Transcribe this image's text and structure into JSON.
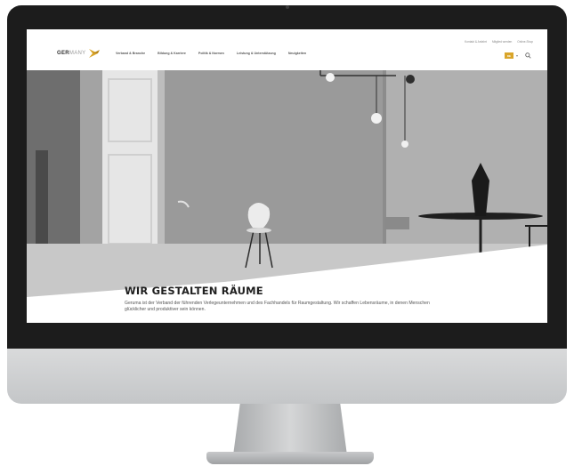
{
  "site": {
    "logo_text": "GERMANY",
    "logo_brand": "GER",
    "logo_suffix": "MANY"
  },
  "main_nav": [
    {
      "label": "Verband & Branche"
    },
    {
      "label": "Bildung & Karriere"
    },
    {
      "label": "Politik & Normen"
    },
    {
      "label": "Leistung & Unterstützung"
    },
    {
      "label": "Neuigkeiten"
    }
  ],
  "utility_nav": [
    {
      "label": "Kontakt & Anfahrt"
    },
    {
      "label": "Mitglied werden"
    },
    {
      "label": "Online-Shop"
    }
  ],
  "header_tools": {
    "language": "DE",
    "search_icon": "search-icon"
  },
  "hero": {
    "title": "WIR GESTALTEN RÄUME",
    "text": "Geruma ist der Verband der führenden Verlegeunternehmen und des Fachhandels für Raumgestaltung. Wir schaffen Lebensräume, in denen Menschen glücklicher und produktiver sein können."
  },
  "colors": {
    "accent": "#d9a52a",
    "hero_bg": "#9b9b9b",
    "bezel": "#1c1c1c"
  }
}
